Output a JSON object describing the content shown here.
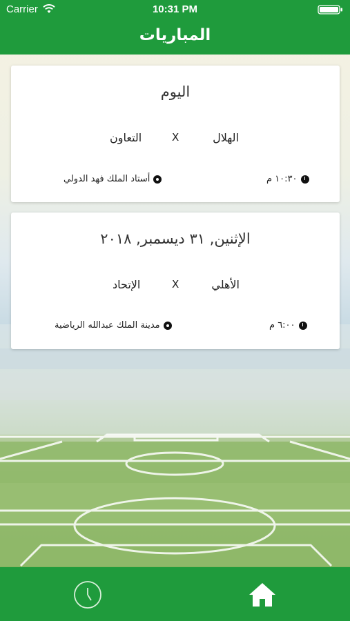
{
  "status_bar": {
    "carrier": "Carrier",
    "time": "10:31 PM"
  },
  "nav": {
    "title": "المباريات"
  },
  "matches": [
    {
      "date": "اليوم",
      "home_team": "الهلال",
      "vs": "X",
      "away_team": "التعاون",
      "time": "١٠:٣٠ م",
      "stadium": "أستاد الملك فهد الدولي"
    },
    {
      "date": "الإثنين, ٣١ ديسمبر, ٢٠١٨",
      "home_team": "الأهلي",
      "vs": "X",
      "away_team": "الإتحاد",
      "time": "٦:٠٠ م",
      "stadium": "مدينة الملك عبدالله الرياضية"
    }
  ],
  "tabbar": {
    "tabs": [
      {
        "icon": "clock-icon"
      },
      {
        "icon": "home-icon"
      }
    ]
  },
  "colors": {
    "primary": "#1f9b3c",
    "card": "#ffffff"
  }
}
